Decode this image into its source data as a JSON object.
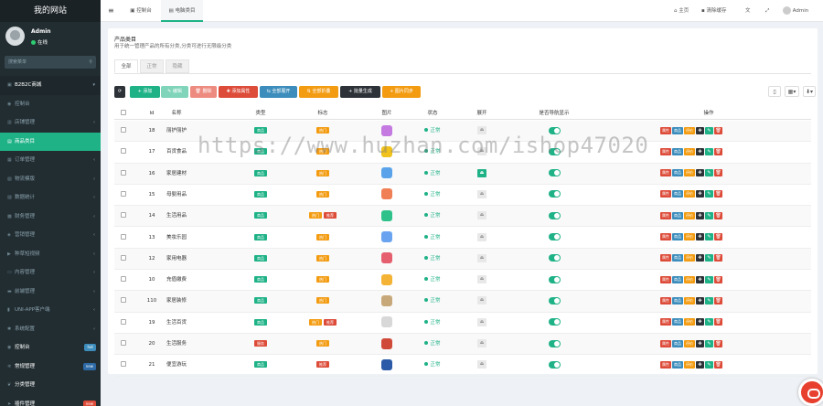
{
  "brand": "我的网站",
  "user": {
    "name": "Admin",
    "status": "在线"
  },
  "search": {
    "placeholder": "搜索菜单"
  },
  "colors": {
    "sidebar": "#222d32",
    "accent": "#1fb287",
    "danger": "#dd4b39",
    "warning": "#f39c12",
    "primary": "#3c8dbc",
    "dark": "#2d3238"
  },
  "sidebar": {
    "items": [
      {
        "label": "B2B2C商城",
        "icon": "shopping-icon",
        "type": "header"
      },
      {
        "label": "控制台",
        "icon": "dashboard-icon"
      },
      {
        "label": "店铺管理",
        "icon": "store-icon",
        "caret": true
      },
      {
        "label": "商品类目",
        "icon": "list-icon",
        "active": true
      },
      {
        "label": "订单管理",
        "icon": "order-icon",
        "caret": true
      },
      {
        "label": "物流模版",
        "icon": "truck-icon",
        "caret": true
      },
      {
        "label": "数据统计",
        "icon": "chart-icon",
        "caret": true
      },
      {
        "label": "财务管理",
        "icon": "money-icon",
        "caret": true
      },
      {
        "label": "营销管理",
        "icon": "tag-icon",
        "caret": true
      },
      {
        "label": "种草短视频",
        "icon": "video-icon",
        "caret": true
      },
      {
        "label": "内容管理",
        "icon": "file-icon",
        "caret": true
      },
      {
        "label": "前端管理",
        "icon": "desktop-icon",
        "caret": true
      },
      {
        "label": "UNI-APP客户端",
        "icon": "mobile-icon",
        "caret": true
      },
      {
        "label": "系统配置",
        "icon": "cog-icon",
        "caret": true
      },
      {
        "label": "控制台",
        "icon": "dashboard-icon",
        "badge": "hot",
        "badge_color": "#3c8dbc",
        "bright": true
      },
      {
        "label": "常规管理",
        "icon": "cogs-icon",
        "badge": "new",
        "badge_color": "#2d6aa6",
        "bright": true
      },
      {
        "label": "分类管理",
        "icon": "leaf-icon",
        "bright": true
      },
      {
        "label": "插件管理",
        "icon": "rocket-icon",
        "badge": "new",
        "badge_color": "#dd4b39",
        "bright": true
      }
    ]
  },
  "topbar": {
    "menu_icon": "≡",
    "tabs": [
      {
        "label": "控制台",
        "icon": "dashboard-icon"
      },
      {
        "label": "电脑类目",
        "icon": "list-icon",
        "active": true
      }
    ],
    "right": [
      {
        "label": "主页",
        "icon": "home-icon"
      },
      {
        "label": "清除缓存",
        "icon": "trash-icon"
      },
      {
        "label": "",
        "icon": "language-icon"
      },
      {
        "label": "",
        "icon": "fullscreen-icon"
      },
      {
        "label": "Admin",
        "icon": "avatar"
      }
    ]
  },
  "panel": {
    "title": "产品类目",
    "desc": "用于统一管理产品的所有分类,分类可进行无限级分类",
    "subtabs": [
      "全部",
      "正常",
      "隐藏"
    ]
  },
  "toolbar": [
    {
      "label": "",
      "icon": "refresh-icon",
      "color": "#2d3238"
    },
    {
      "label": "+ 添加",
      "color": "#1fb287"
    },
    {
      "label": "✎ 编辑",
      "color": "#7fd4b9"
    },
    {
      "label": "🗑 删除",
      "color": "#ee8b80"
    },
    {
      "label": "✚ 添加属性",
      "color": "#dd4b39"
    },
    {
      "label": "⇆ 全部展开",
      "color": "#3c8dbc"
    },
    {
      "label": "⇅ 全部折叠",
      "color": "#f39c12"
    },
    {
      "label": "+ 批量生成",
      "color": "#2d3238"
    },
    {
      "label": "+ 图片同步",
      "color": "#f39c12"
    }
  ],
  "table": {
    "headers": [
      "Id",
      "名称",
      "类型",
      "标志",
      "图片",
      "状态",
      "展开",
      "是否导航显示",
      "操作"
    ],
    "rows": [
      {
        "id": "18",
        "name": "丽护丽护",
        "type": "商品",
        "flags": [
          "热门"
        ],
        "img_color": "#c47ae0",
        "status": "正常",
        "expand": false
      },
      {
        "id": "17",
        "name": "百货食品",
        "type": "商品",
        "flags": [
          "热门"
        ],
        "img_color": "#f0c21b",
        "status": "正常",
        "expand": false
      },
      {
        "id": "16",
        "name": "家居建材",
        "type": "商品",
        "flags": [
          "热门"
        ],
        "img_color": "#5aa3ea",
        "status": "正常",
        "expand": true
      },
      {
        "id": "15",
        "name": "母婴用品",
        "type": "商品",
        "flags": [
          "热门"
        ],
        "img_color": "#f07f55",
        "status": "正常",
        "expand": false
      },
      {
        "id": "14",
        "name": "生活用品",
        "type": "商品",
        "flags": [
          "热门",
          "推荐"
        ],
        "img_color": "#2ec28a",
        "status": "正常",
        "expand": false
      },
      {
        "id": "13",
        "name": "美妆乐园",
        "type": "商品",
        "flags": [
          "热门"
        ],
        "img_color": "#6aa4f0",
        "status": "正常",
        "expand": false
      },
      {
        "id": "12",
        "name": "家用电器",
        "type": "商品",
        "flags": [
          "热门"
        ],
        "img_color": "#e55f6e",
        "status": "正常",
        "expand": false
      },
      {
        "id": "10",
        "name": "充值缴费",
        "type": "商品",
        "flags": [
          "热门"
        ],
        "img_color": "#f5b335",
        "status": "正常",
        "expand": false
      },
      {
        "id": "110",
        "name": "家居装修",
        "type": "商品",
        "flags": [
          "热门"
        ],
        "img_color": "#c7a87a",
        "status": "正常",
        "expand": false
      },
      {
        "id": "19",
        "name": "生活百货",
        "type": "商品",
        "flags": [
          "热门",
          "推荐"
        ],
        "img_color": "#d8d8d8",
        "status": "正常",
        "expand": false
      },
      {
        "id": "20",
        "name": "生活服务",
        "type": "服务",
        "flags": [
          "热门"
        ],
        "img_color": "#d04a3a",
        "status": "正常",
        "expand": false
      },
      {
        "id": "21",
        "name": "便宜游玩",
        "type": "商品",
        "flags": [
          "推荐"
        ],
        "img_color": "#2a5aa8",
        "status": "正常",
        "expand": false
      }
    ],
    "row_actions": [
      {
        "label": "属性",
        "color": "#dd4b39"
      },
      {
        "label": "商品",
        "color": "#3c8dbc"
      },
      {
        "label": "评价",
        "color": "#f39c12"
      },
      {
        "label": "✥",
        "color": "#2d3238",
        "icon": true
      },
      {
        "label": "✎",
        "color": "#1fb287",
        "icon": true
      },
      {
        "label": "🗑",
        "color": "#dd4b39",
        "icon": true
      }
    ]
  },
  "watermark": "https://www.huzhan.com/ishop47020"
}
